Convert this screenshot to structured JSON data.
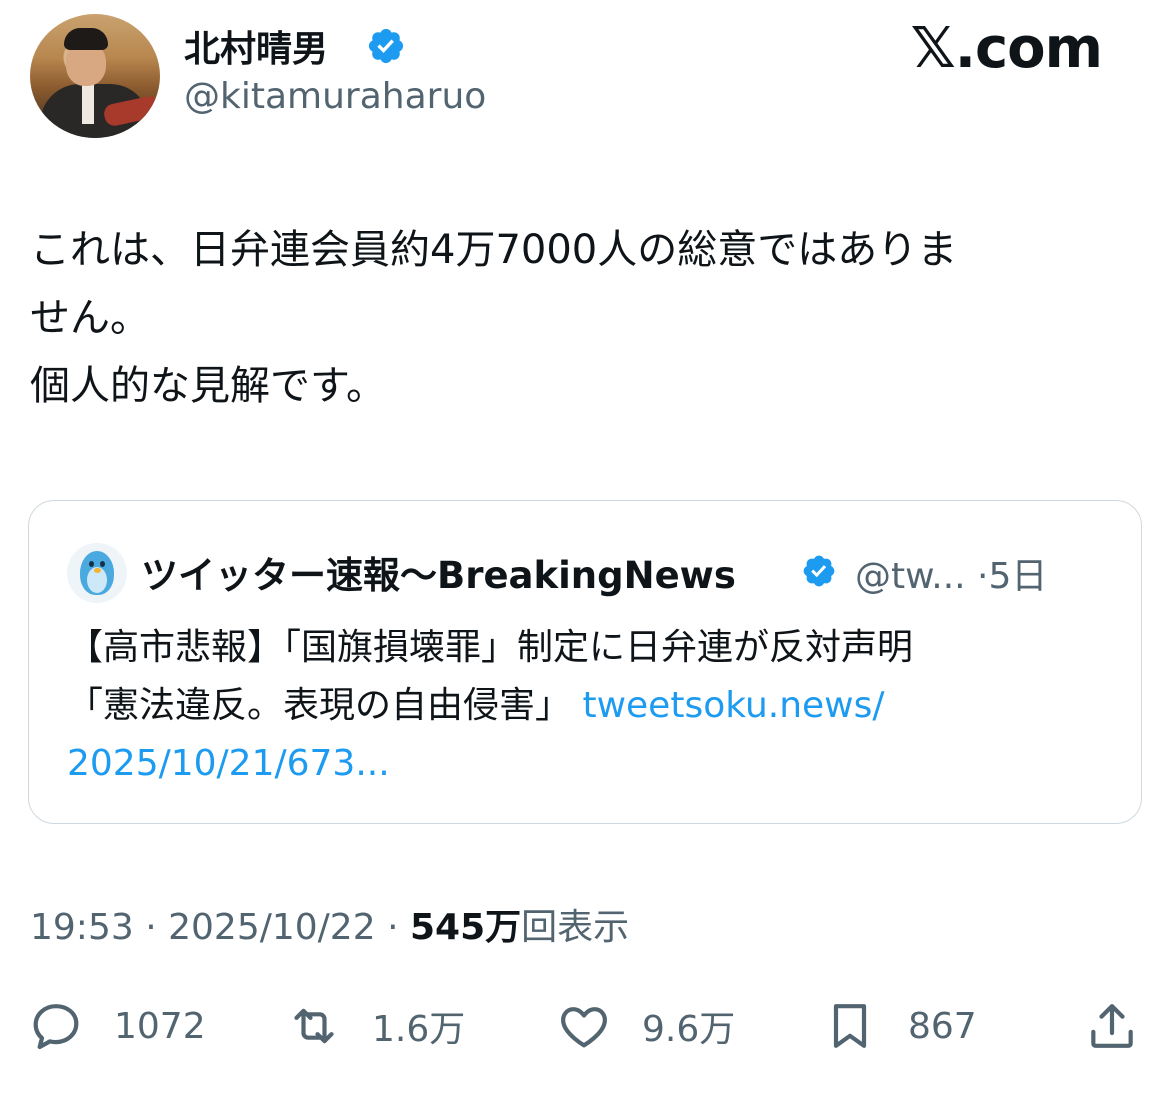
{
  "author": {
    "name": "北村晴男",
    "handle": "@kitamuraharuo",
    "verified": true
  },
  "site_logo": "𝕏.com",
  "tweet": {
    "line1": "これは、日弁連会員約4万7000人の総意ではありま",
    "line2": "せん。",
    "line3": "個人的な見解です。"
  },
  "quoted": {
    "name": "ツイッター速報〜BreakingNews",
    "handle": "@tw...",
    "separator": "·",
    "time": "5日",
    "text_line1": "【高市悲報】「国旗損壊罪」制定に日弁連が反対声明",
    "text_line2": "「憲法違反。表現の自由侵害」",
    "link_part1": "tweetsoku.news/",
    "link_part2": "2025/10/21/673..."
  },
  "meta": {
    "time": "19:53",
    "sep1": "·",
    "date": "2025/10/22",
    "sep2": "·",
    "views_count": "545万",
    "views_label": "回表示"
  },
  "actions": {
    "replies": "1072",
    "reposts": "1.6万",
    "likes": "9.6万",
    "bookmarks": "867"
  },
  "colors": {
    "text": "#0f1419",
    "secondary": "#536471",
    "link": "#1d9bf0",
    "verified": "#1d9bf0",
    "border": "#cfd9de"
  }
}
